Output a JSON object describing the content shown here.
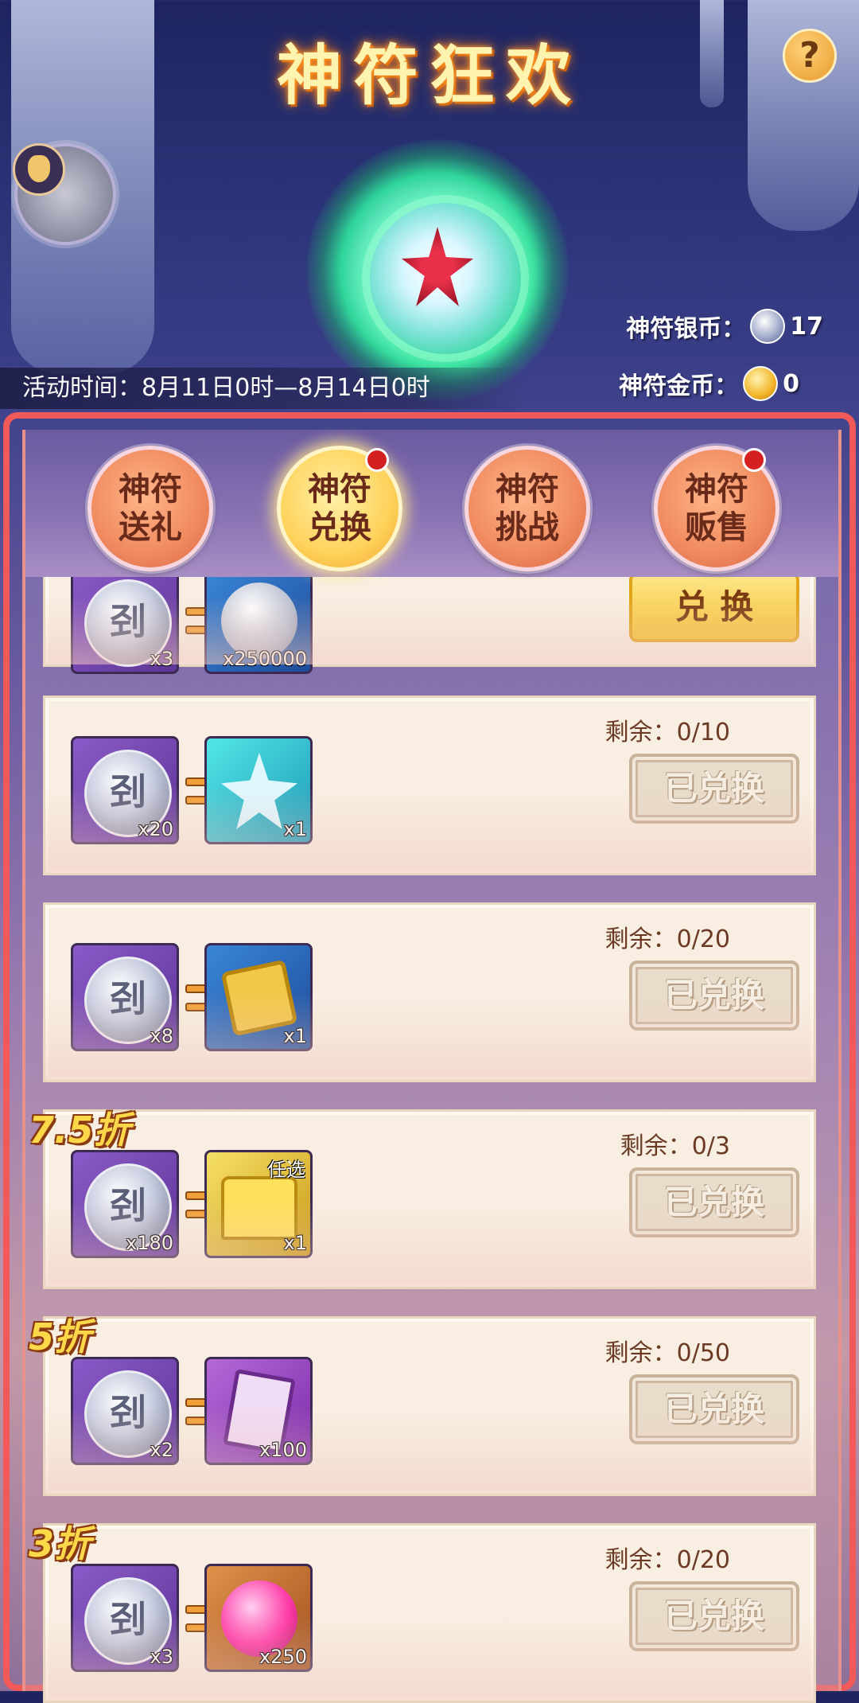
{
  "header": {
    "title": "神符狂欢",
    "help_symbol": "?",
    "event_time": "活动时间：8月11日0时—8月14日0时",
    "silver_label": "神符银币：",
    "silver_value": "17",
    "gold_label": "神符金币：",
    "gold_value": "0"
  },
  "tabs": [
    {
      "label_line1": "神符",
      "label_line2": "送礼",
      "active": false,
      "red_dot": false
    },
    {
      "label_line1": "神符",
      "label_line2": "兑换",
      "active": true,
      "red_dot": true
    },
    {
      "label_line1": "神符",
      "label_line2": "挑战",
      "active": false,
      "red_dot": false
    },
    {
      "label_line1": "神符",
      "label_line2": "贩售",
      "active": false,
      "red_dot": true
    }
  ],
  "rows": [
    {
      "cost_qty": "x3",
      "reward_qty": "x250000",
      "reward_icon": "silver-coin-pile-icon",
      "button": "兑 换",
      "button_style": "gold",
      "remain": "",
      "discount": ""
    },
    {
      "cost_qty": "x20",
      "reward_qty": "x1",
      "reward_icon": "crystal-star-icon",
      "button": "已兑换",
      "button_style": "done",
      "remain": "剩余：0/10",
      "discount": ""
    },
    {
      "cost_qty": "x8",
      "reward_qty": "x1",
      "reward_icon": "jade-pendant-token-icon",
      "button": "已兑换",
      "button_style": "done",
      "remain": "剩余：0/20",
      "discount": ""
    },
    {
      "cost_qty": "x180",
      "reward_qty": "x1",
      "reward_icon": "gold-chest-icon",
      "reward_tag": "任选",
      "button": "已兑换",
      "button_style": "done",
      "remain": "剩余：0/3",
      "discount": "7.5折"
    },
    {
      "cost_qty": "x2",
      "reward_qty": "x100",
      "reward_icon": "purple-card-icon",
      "button": "已兑换",
      "button_style": "done",
      "remain": "剩余：0/50",
      "discount": "5折"
    },
    {
      "cost_qty": "x3",
      "reward_qty": "x250",
      "reward_icon": "pink-orb-icon",
      "button": "已兑换",
      "button_style": "done",
      "remain": "剩余：0/20",
      "discount": "3折"
    }
  ],
  "cost_coin_glyph": "刭"
}
